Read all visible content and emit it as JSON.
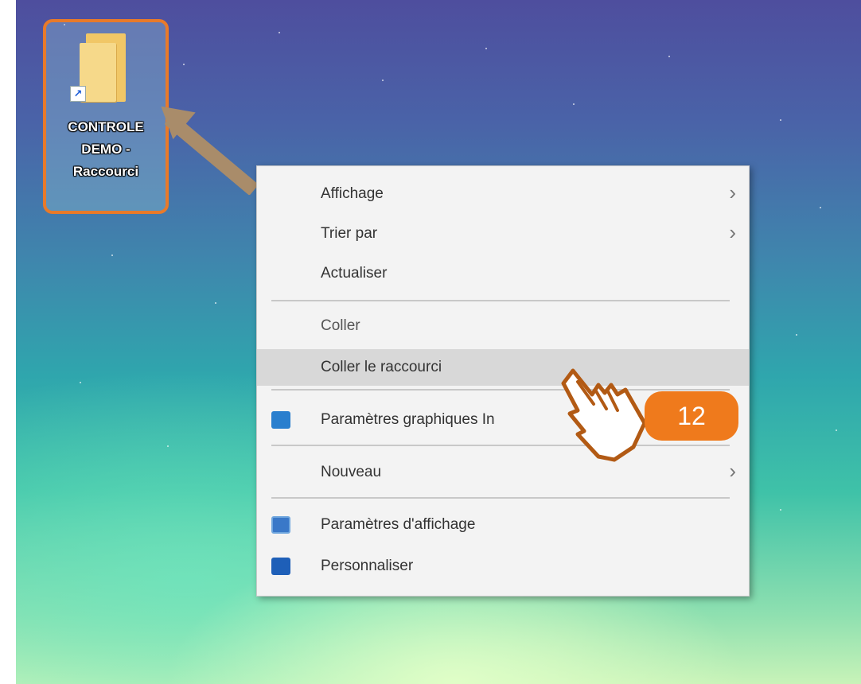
{
  "desktop_icon": {
    "label_line1": "CONTROLE",
    "label_line2": "DEMO -",
    "label_line3": "Raccourci"
  },
  "context_menu": {
    "items": [
      {
        "label": "Affichage",
        "has_submenu": true
      },
      {
        "label": "Trier par",
        "has_submenu": true
      },
      {
        "label": "Actualiser",
        "has_submenu": false
      },
      {
        "label": "Coller",
        "has_submenu": false
      },
      {
        "label": "Coller le raccourci",
        "has_submenu": false,
        "highlighted": true
      },
      {
        "label": "Paramètres graphiques In",
        "has_submenu": false,
        "icon": "graphics-icon"
      },
      {
        "label": "Nouveau",
        "has_submenu": true
      },
      {
        "label": "Paramètres d'affichage",
        "has_submenu": false,
        "icon": "display-icon"
      },
      {
        "label": "Personnaliser",
        "has_submenu": false,
        "icon": "personalize-icon"
      }
    ],
    "submenu_glyph": "›"
  },
  "step_badge": {
    "number": "12"
  },
  "colors": {
    "highlight_border": "#e87a2a",
    "badge": "#ef7a1c",
    "arrow": "#a98c6a"
  }
}
